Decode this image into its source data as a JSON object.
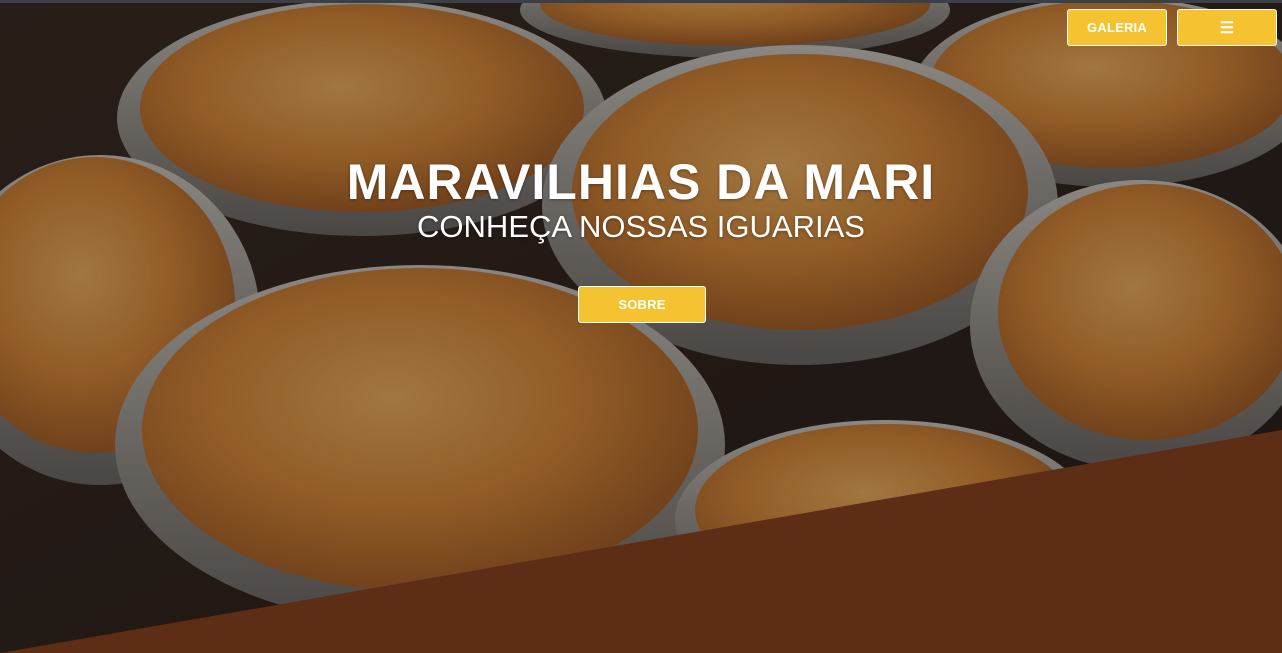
{
  "nav": {
    "galeria_label": "GALERIA",
    "menu_label": "☰",
    "menu_icon": "hamburger-menu-icon"
  },
  "hero": {
    "title": "MARAVILHIAS DA MARI",
    "subtitle": "CONHEÇA NOSSAS IGUARIAS",
    "cta_label": "SOBRE",
    "image_subject": "baked pot pies (empadões) in foil tins"
  },
  "colors": {
    "accent": "#f5c232",
    "footer_band": "#5e2d16",
    "overlay": "rgba(0,0,0,0.35)"
  }
}
